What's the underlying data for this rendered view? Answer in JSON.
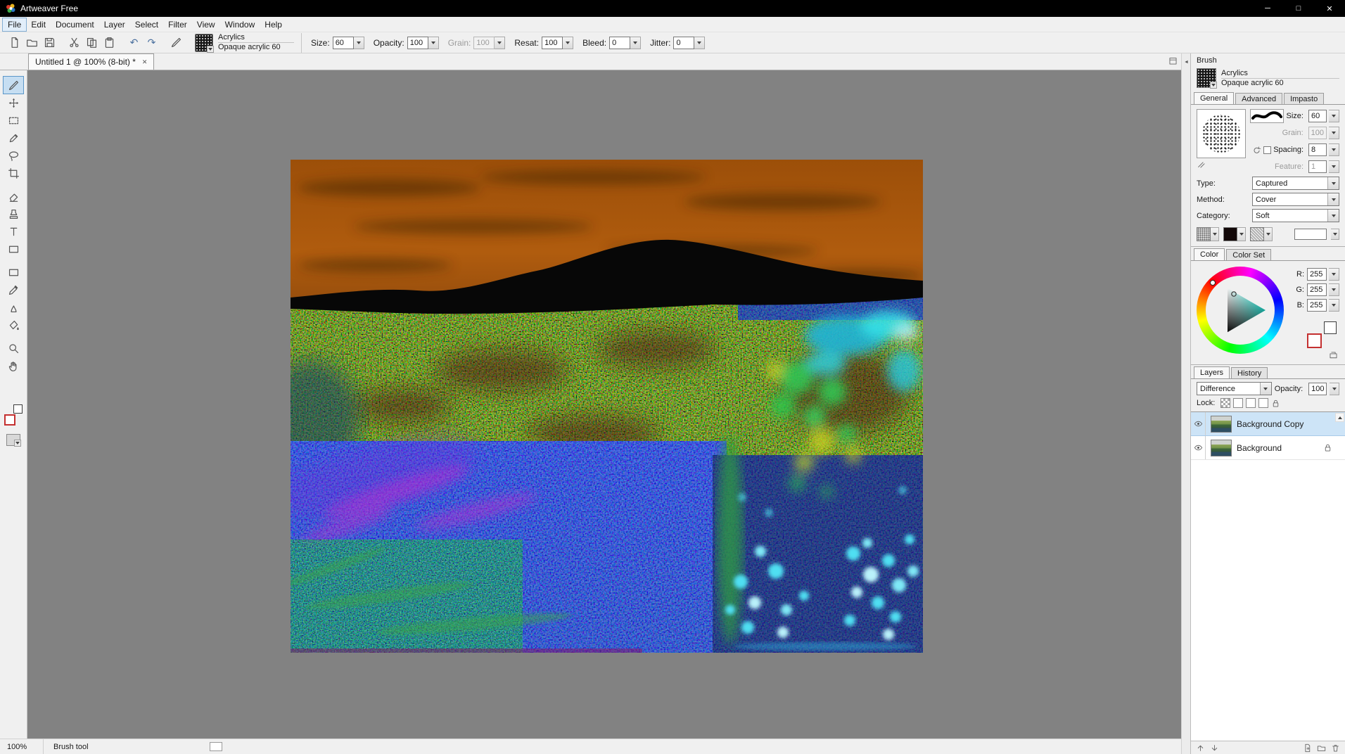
{
  "window": {
    "title": "Artweaver Free"
  },
  "glyphs": {
    "minimize": "─",
    "maximize": "□",
    "close": "✕",
    "undo": "↶",
    "redo": "↷"
  },
  "menu": {
    "items": [
      "File",
      "Edit",
      "Document",
      "Layer",
      "Select",
      "Filter",
      "View",
      "Window",
      "Help"
    ]
  },
  "toolbar": {
    "brush_name": "Acrylics",
    "brush_variant": "Opaque acrylic 60",
    "fields": [
      {
        "label": "Size:",
        "value": "60"
      },
      {
        "label": "Opacity:",
        "value": "100"
      },
      {
        "label": "Grain:",
        "value": "100"
      },
      {
        "label": "Resat:",
        "value": "100"
      },
      {
        "label": "Bleed:",
        "value": "0"
      },
      {
        "label": "Jitter:",
        "value": "0"
      }
    ]
  },
  "tabstrip": {
    "document_tab": "Untitled 1 @ 100% (8-bit) *"
  },
  "brush_panel": {
    "title": "Brush",
    "brush_name": "Acrylics",
    "brush_variant": "Opaque acrylic 60",
    "tabs": [
      "General",
      "Advanced",
      "Impasto"
    ],
    "size_label": "Size:",
    "size_value": "60",
    "grain_label": "Grain:",
    "grain_value": "100",
    "spacing_label": "Spacing:",
    "spacing_value": "8",
    "feature_label": "Feature:",
    "feature_value": "1",
    "type_label": "Type:",
    "type_value": "Captured",
    "method_label": "Method:",
    "method_value": "Cover",
    "category_label": "Category:",
    "category_value": "Soft"
  },
  "color_panel": {
    "tabs": [
      "Color",
      "Color Set"
    ],
    "r_label": "R:",
    "r_value": "255",
    "g_label": "G:",
    "g_value": "255",
    "b_label": "B:",
    "b_value": "255"
  },
  "layers_panel": {
    "tabs": [
      "Layers",
      "History"
    ],
    "blend_mode": "Difference",
    "opacity_label": "Opacity:",
    "opacity_value": "100",
    "lock_label": "Lock:",
    "layers": [
      {
        "name": "Background Copy"
      },
      {
        "name": "Background"
      }
    ]
  },
  "statusbar": {
    "zoom": "100%",
    "tool": "Brush tool"
  },
  "colors": {
    "selection": "#cde4f7",
    "canvas_bg": "#828282",
    "titlebar": "#000000",
    "sky_orange": "#a8540e",
    "current_color": "#ffffff"
  }
}
